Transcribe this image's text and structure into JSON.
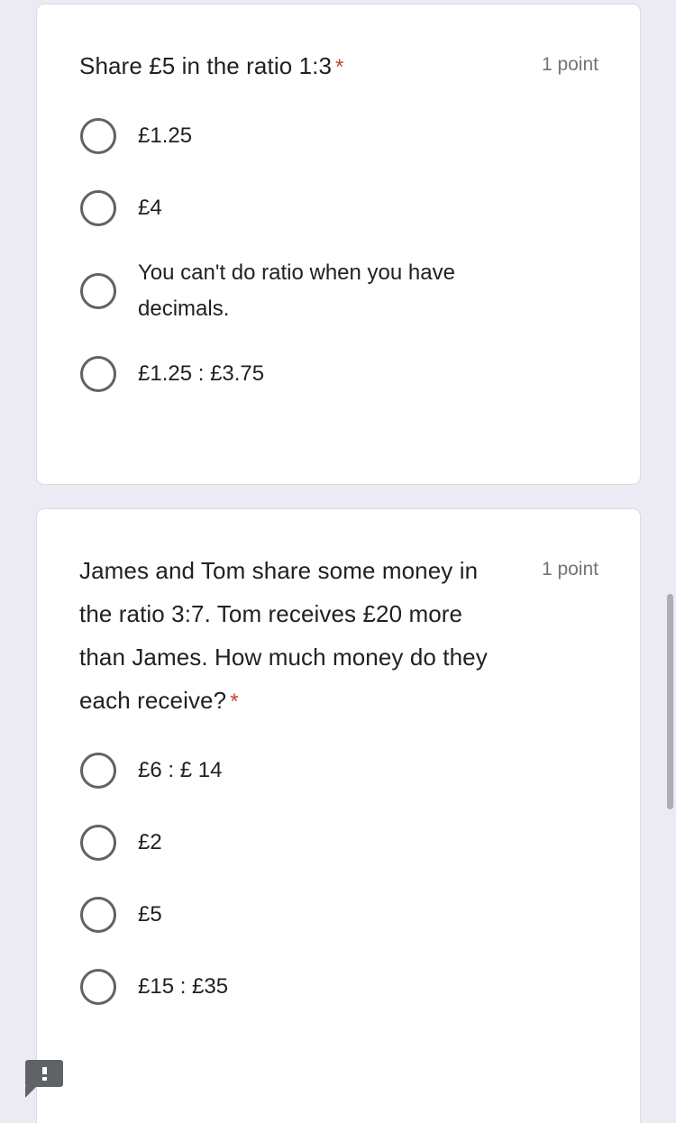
{
  "page": {
    "background_color": "#ECEBF3",
    "card_color": "#FFFFFF",
    "required_marker": "*",
    "required_color": "#C5412F",
    "text_color": "#202124",
    "muted_color": "#70757A",
    "radio_color": "#5F6368"
  },
  "questions": [
    {
      "title": "Share £5 in the ratio 1:3",
      "required_marker": "*",
      "points": "1 point",
      "options": [
        {
          "label": "£1.25"
        },
        {
          "label": "£4"
        },
        {
          "label": "You can't do ratio when you have decimals."
        },
        {
          "label": "£1.25 : £3.75"
        }
      ]
    },
    {
      "title": "James and Tom share some money in the ratio 3:7. Tom receives £20 more than James. How much money do they each receive?",
      "required_marker": "*",
      "points": "1 point",
      "options": [
        {
          "label": "£6 : £ 14"
        },
        {
          "label": "£2"
        },
        {
          "label": "£5"
        },
        {
          "label": "£15 : £35"
        }
      ]
    }
  ],
  "report_badge": {
    "icon": "exclamation-speech-bubble-icon",
    "color": "#5F6368"
  },
  "scrollbar": {
    "thumb_color": "#ACABB6",
    "track_color": "#ECEBF3"
  }
}
